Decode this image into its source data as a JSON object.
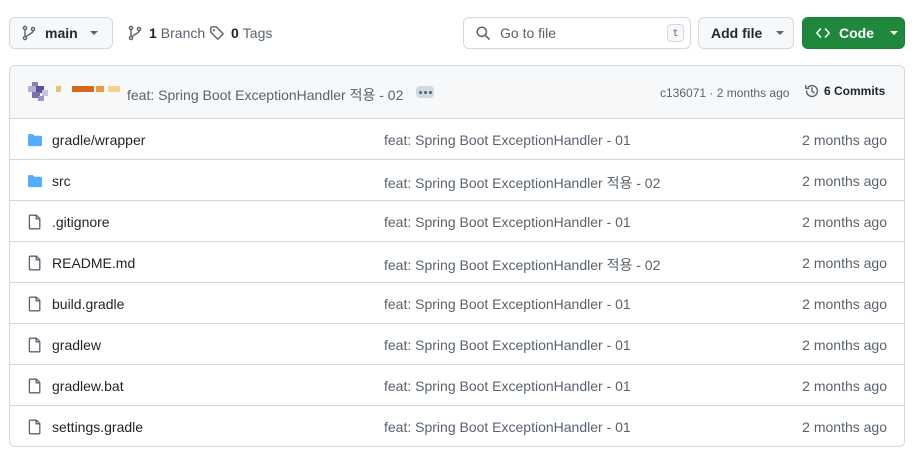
{
  "toolbar": {
    "branch_name": "main",
    "branch_count": "1",
    "branch_label": "Branch",
    "tag_count": "0",
    "tag_label": "Tags",
    "goto_placeholder": "Go to file",
    "goto_shortcut": "t",
    "add_file_label": "Add file",
    "code_label": "Code",
    "code_color": "#1f883d"
  },
  "latest_commit": {
    "message": "feat: Spring Boot ExceptionHandler 적용 - 02",
    "hash": "c136071",
    "separator": "·",
    "age": "2 months ago",
    "commit_count_label": "6 Commits"
  },
  "files": [
    {
      "name": "gradle/wrapper",
      "type": "folder",
      "icon": "folder-icon",
      "message": "feat: Spring Boot ExceptionHandler - 01",
      "age": "2 months ago"
    },
    {
      "name": "src",
      "type": "folder",
      "icon": "folder-icon",
      "message": "feat: Spring Boot ExceptionHandler 적용 - 02",
      "age": "2 months ago"
    },
    {
      "name": ".gitignore",
      "type": "file",
      "icon": "file-icon",
      "message": "feat: Spring Boot ExceptionHandler - 01",
      "age": "2 months ago"
    },
    {
      "name": "README.md",
      "type": "file",
      "icon": "file-icon",
      "message": "feat: Spring Boot ExceptionHandler 적용 - 02",
      "age": "2 months ago"
    },
    {
      "name": "build.gradle",
      "type": "file",
      "icon": "file-icon",
      "message": "feat: Spring Boot ExceptionHandler - 01",
      "age": "2 months ago"
    },
    {
      "name": "gradlew",
      "type": "file",
      "icon": "file-icon",
      "message": "feat: Spring Boot ExceptionHandler - 01",
      "age": "2 months ago"
    },
    {
      "name": "gradlew.bat",
      "type": "file",
      "icon": "file-icon",
      "message": "feat: Spring Boot ExceptionHandler - 01",
      "age": "2 months ago"
    },
    {
      "name": "settings.gradle",
      "type": "file",
      "icon": "file-icon",
      "message": "feat: Spring Boot ExceptionHandler - 01",
      "age": "2 months ago"
    }
  ]
}
